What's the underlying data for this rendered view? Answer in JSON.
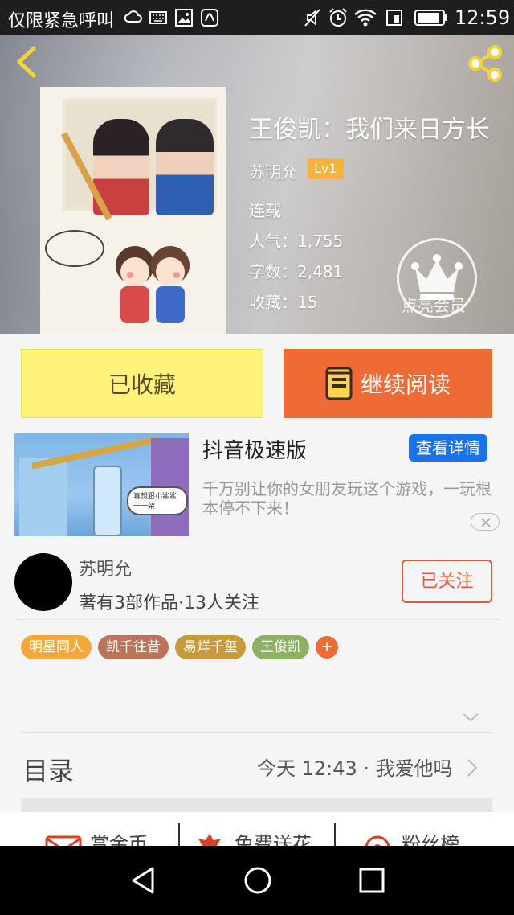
{
  "status_bar": {
    "notification_text": "仅限紧急呼叫",
    "time": "12:59",
    "icons": [
      "cloud-icon",
      "keyboard-icon",
      "image-icon",
      "huawei-icon",
      "mute-icon",
      "alarm-icon",
      "wifi-icon",
      "sim-icon",
      "battery-icon"
    ]
  },
  "header": {
    "back_icon": "back-chevron-icon",
    "share_icon": "share-icon"
  },
  "book": {
    "title": "王俊凯：我们来日方长",
    "author": "苏明允",
    "author_level": "Lv1",
    "status": "连载",
    "popularity_label": "人气：",
    "popularity": "1,755",
    "word_count_label": "字数：",
    "word_count": "2,481",
    "favorites_label": "收藏：",
    "favorites": "15",
    "vip_label": "点亮会员"
  },
  "actions": {
    "favorited_label": "已收藏",
    "continue_reading_label": "继续阅读"
  },
  "ad": {
    "title": "抖音极速版",
    "details_button": "查看详情",
    "description": "千万别让你的女朋友玩这个游戏，一玩根本停不下来！",
    "image_caption": "真想跟小鲨鲨干一架"
  },
  "author_card": {
    "name": "苏明允",
    "stats": "著有3部作品·13人关注",
    "follow_button": "已关注"
  },
  "tags": [
    {
      "label": "明星同人",
      "color": "#f3a83b"
    },
    {
      "label": "凯千往昔",
      "color": "#b9745a"
    },
    {
      "label": "易烊千玺",
      "color": "#c89a3c"
    },
    {
      "label": "王俊凯",
      "color": "#8bb162"
    }
  ],
  "add_tag_label": "+",
  "toc": {
    "label": "目录",
    "latest": "今天 12:43 · 我爱他吗"
  },
  "bottom_tabs": [
    {
      "label": "赏金币",
      "icon": "envelope-icon"
    },
    {
      "label": "免费送花",
      "icon": "flower-icon"
    },
    {
      "label": "粉丝榜",
      "icon": "ranking-icon"
    }
  ],
  "colors": {
    "accent_orange": "#ef6b35",
    "favorite_yellow": "#fff27a",
    "level_badge": "#f3b33d",
    "ad_blue": "#1a73e8",
    "follow_red": "#e35a3a"
  }
}
